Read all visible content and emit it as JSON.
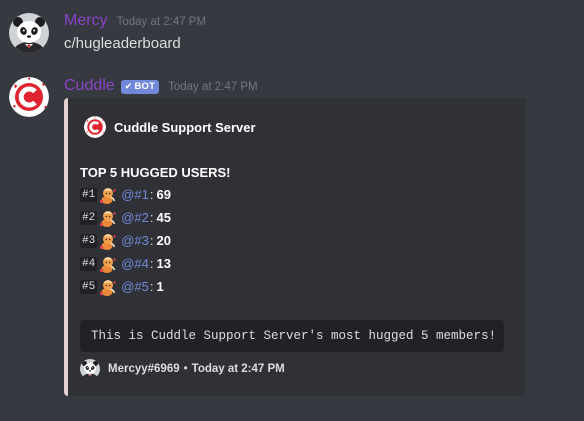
{
  "messages": [
    {
      "author": "Mercy",
      "timestamp": "Today at 2:47 PM",
      "content": "c/hugleaderboard",
      "author_color": "#8a44c8",
      "avatar_icon": "panda-avatar"
    },
    {
      "author": "Cuddle",
      "bot_tag": "BOT",
      "timestamp": "Today at 2:47 PM",
      "author_color": "#8a44c8",
      "avatar_icon": "cuddle-logo-avatar"
    }
  ],
  "embed": {
    "border_color": "#e8cfcf",
    "author_name": "Cuddle Support Server",
    "title": "TOP 5 HUGGED USERS!",
    "leaderboard": [
      {
        "rank": "#1",
        "mention": "@#1",
        "score": "69"
      },
      {
        "rank": "#2",
        "mention": "@#2",
        "score": "45"
      },
      {
        "rank": "#3",
        "mention": "@#3",
        "score": "20"
      },
      {
        "rank": "#4",
        "mention": "@#4",
        "score": "13"
      },
      {
        "rank": "#5",
        "mention": "@#5",
        "score": "1"
      }
    ],
    "description_code": "This is Cuddle Support Server's most hugged 5 members!",
    "footer": {
      "text": "Mercyy#6969",
      "separator": "•",
      "timestamp": "Today at 2:47 PM"
    }
  },
  "colors": {
    "background": "#36393f",
    "embed_background": "#2f3136",
    "mention": "#7289da",
    "bot_tag": "#7289da",
    "timestamp": "#72767d"
  }
}
